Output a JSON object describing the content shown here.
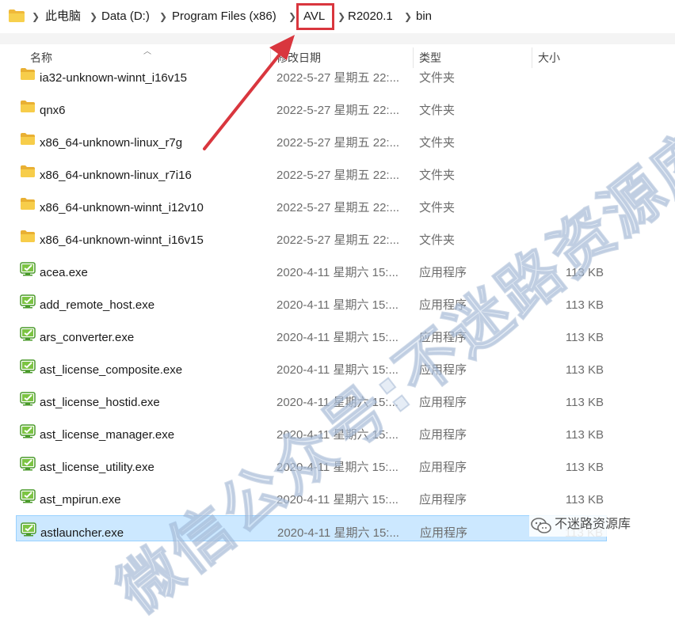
{
  "breadcrumb": [
    "此电脑",
    "Data (D:)",
    "Program Files (x86)",
    "AVL",
    "R2020.1",
    "bin"
  ],
  "columns": {
    "name": "名称",
    "date": "修改日期",
    "type": "类型",
    "size": "大小"
  },
  "rows": [
    {
      "name": "ia32-unknown-winnt_i16v15",
      "date": "2022-5-27 星期五 22:...",
      "type": "文件夹",
      "size": "",
      "icon": "folder-icon"
    },
    {
      "name": "qnx6",
      "date": "2022-5-27 星期五 22:...",
      "type": "文件夹",
      "size": "",
      "icon": "folder-icon"
    },
    {
      "name": "x86_64-unknown-linux_r7g",
      "date": "2022-5-27 星期五 22:...",
      "type": "文件夹",
      "size": "",
      "icon": "folder-icon"
    },
    {
      "name": "x86_64-unknown-linux_r7i16",
      "date": "2022-5-27 星期五 22:...",
      "type": "文件夹",
      "size": "",
      "icon": "folder-icon"
    },
    {
      "name": "x86_64-unknown-winnt_i12v10",
      "date": "2022-5-27 星期五 22:...",
      "type": "文件夹",
      "size": "",
      "icon": "folder-icon"
    },
    {
      "name": "x86_64-unknown-winnt_i16v15",
      "date": "2022-5-27 星期五 22:...",
      "type": "文件夹",
      "size": "",
      "icon": "folder-icon"
    },
    {
      "name": "acea.exe",
      "date": "2020-4-11 星期六 15:...",
      "type": "应用程序",
      "size": "113 KB",
      "icon": "exe-icon"
    },
    {
      "name": "add_remote_host.exe",
      "date": "2020-4-11 星期六 15:...",
      "type": "应用程序",
      "size": "113 KB",
      "icon": "exe-icon"
    },
    {
      "name": "ars_converter.exe",
      "date": "2020-4-11 星期六 15:...",
      "type": "应用程序",
      "size": "113 KB",
      "icon": "exe-icon"
    },
    {
      "name": "ast_license_composite.exe",
      "date": "2020-4-11 星期六 15:...",
      "type": "应用程序",
      "size": "113 KB",
      "icon": "exe-icon"
    },
    {
      "name": "ast_license_hostid.exe",
      "date": "2020-4-11 星期六 15:...",
      "type": "应用程序",
      "size": "113 KB",
      "icon": "exe-icon"
    },
    {
      "name": "ast_license_manager.exe",
      "date": "2020-4-11 星期六 15:...",
      "type": "应用程序",
      "size": "113 KB",
      "icon": "exe-icon"
    },
    {
      "name": "ast_license_utility.exe",
      "date": "2020-4-11 星期六 15:...",
      "type": "应用程序",
      "size": "113 KB",
      "icon": "exe-icon"
    },
    {
      "name": "ast_mpirun.exe",
      "date": "2020-4-11 星期六 15:...",
      "type": "应用程序",
      "size": "113 KB",
      "icon": "exe-icon"
    },
    {
      "name": "astlauncher.exe",
      "date": "2020-4-11 星期六 15:...",
      "type": "应用程序",
      "size": "113 KB",
      "icon": "exe-icon",
      "selected": true
    }
  ],
  "watermark": "微信公众号:不迷路资源库",
  "badge": "不迷路资源库",
  "colors": {
    "highlight_box": "#d9363e",
    "arrow": "#d9363e",
    "selected_row": "#cce8ff",
    "folder": "#f5c342",
    "exe": "#6fbf3a"
  }
}
